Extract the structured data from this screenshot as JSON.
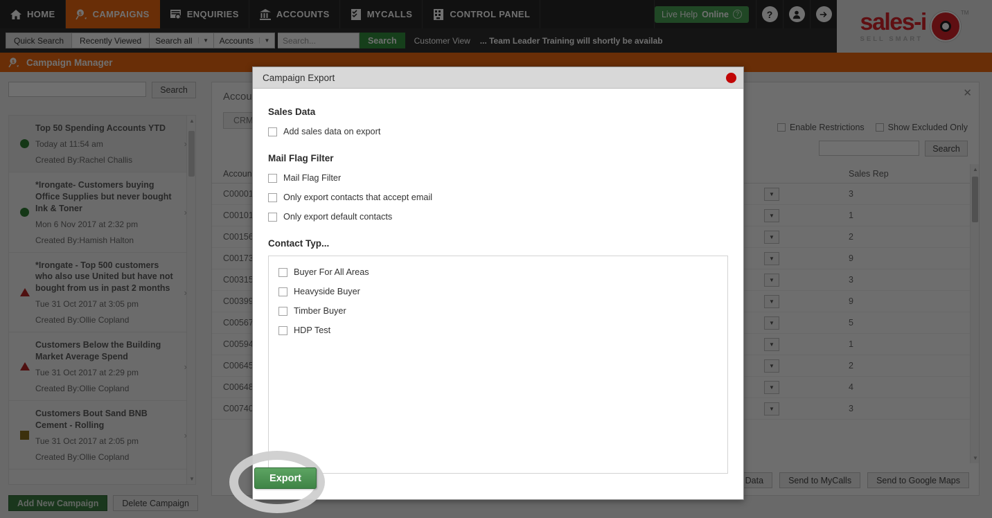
{
  "topnav": {
    "items": [
      {
        "label": "HOME",
        "icon": "home-icon",
        "active": false
      },
      {
        "label": "CAMPAIGNS",
        "icon": "campaigns-icon",
        "active": true
      },
      {
        "label": "ENQUIRIES",
        "icon": "enquiries-icon",
        "active": false
      },
      {
        "label": "ACCOUNTS",
        "icon": "accounts-icon",
        "active": false
      },
      {
        "label": "MYCALLS",
        "icon": "mycalls-icon",
        "active": false
      },
      {
        "label": "CONTROL PANEL",
        "icon": "control-panel-icon",
        "active": false
      }
    ],
    "live_help_prefix": "Live Help",
    "live_help_status": "Online",
    "help_icon": "question-mark-icon",
    "account_icon": "user-avatar-icon",
    "logout_icon": "arrow-right-icon",
    "accent_orange": "#ef6a12",
    "accent_green": "#4aa254"
  },
  "logo": {
    "name": "sales-i",
    "tagline": "SELL SMART",
    "tm": "TM",
    "brand_red": "#d9242a"
  },
  "searchbar": {
    "quick_search": "Quick Search",
    "recently_viewed": "Recently Viewed",
    "scope_select": "Search all",
    "type_select": "Accounts",
    "search_placeholder": "Search...",
    "search_button": "Search",
    "customer_view": "Customer View",
    "ticker": "... Team Leader Training will shortly be availab"
  },
  "page_header": {
    "title": "Campaign Manager",
    "icon": "campaign-manager-icon"
  },
  "sidebar": {
    "search_value": "",
    "search_button": "Search",
    "add_button": "Add New Campaign",
    "delete_button": "Delete Campaign",
    "items": [
      {
        "title": "Top 50 Spending Accounts YTD",
        "date": "Today at 11:54 am",
        "created_by": "Created By:Rachel Challis",
        "status": "green",
        "selected": true
      },
      {
        "title": "*Irongate- Customers buying Office Supplies but never bought Ink & Toner",
        "date": "Mon 6 Nov 2017 at 2:32 pm",
        "created_by": "Created By:Hamish Halton",
        "status": "green",
        "selected": false
      },
      {
        "title": "*Irongate - Top 500 customers who also use United but have not bought from us in past 2 months",
        "date": "Tue 31 Oct 2017 at 3:05 pm",
        "created_by": "Created By:Ollie Copland",
        "status": "red",
        "selected": false
      },
      {
        "title": "Customers Below the Building Market Average Spend",
        "date": "Tue 31 Oct 2017 at 2:29 pm",
        "created_by": "Created By:Ollie Copland",
        "status": "red",
        "selected": false
      },
      {
        "title": "Customers Bout Sand BNB Cement - Rolling",
        "date": "Tue 31 Oct 2017 at 2:05 pm",
        "created_by": "Created By:Ollie Copland",
        "status": "amber",
        "selected": false
      }
    ]
  },
  "main": {
    "title": "Account",
    "close_icon": "close-icon",
    "crm_button": "CRM",
    "enable_restrictions": "Enable Restrictions",
    "show_excluded_only": "Show Excluded Only",
    "search_value": "",
    "search_button": "Search",
    "columns": {
      "account": "Account",
      "sales_rep": "Sales Rep"
    },
    "rows": [
      {
        "account": "C00001",
        "sales_rep": "3"
      },
      {
        "account": "C00101",
        "sales_rep": "1"
      },
      {
        "account": "C00156",
        "sales_rep": "2"
      },
      {
        "account": "C00173",
        "sales_rep": "9"
      },
      {
        "account": "C00315",
        "sales_rep": "3"
      },
      {
        "account": "C00399",
        "sales_rep": "9"
      },
      {
        "account": "C00567",
        "sales_rep": "5"
      },
      {
        "account": "C00594",
        "sales_rep": "1"
      },
      {
        "account": "C00645",
        "sales_rep": "2"
      },
      {
        "account": "C00648",
        "sales_rep": "4"
      },
      {
        "account": "C00740",
        "sales_rep": "3"
      }
    ],
    "footer_buttons": [
      "Export Data",
      "Send to MyCalls",
      "Send to Google Maps"
    ]
  },
  "modal": {
    "title": "Campaign Export",
    "close_icon": "close-circle-icon",
    "close_color": "#c10606",
    "sections": {
      "sales_data": {
        "heading": "Sales Data",
        "options": [
          {
            "label": "Add sales data on export",
            "checked": false
          }
        ]
      },
      "mail_flag_filter": {
        "heading": "Mail Flag Filter",
        "options": [
          {
            "label": "Mail Flag Filter",
            "checked": false
          },
          {
            "label": "Only export contacts that accept email",
            "checked": false
          },
          {
            "label": "Only export default contacts",
            "checked": false
          }
        ]
      },
      "contact_types": {
        "heading": "Contact Typ...",
        "options": [
          {
            "label": "Buyer For All Areas",
            "checked": false
          },
          {
            "label": "Heavyside Buyer",
            "checked": false
          },
          {
            "label": "Timber Buyer",
            "checked": false
          },
          {
            "label": "HDP Test",
            "checked": false
          }
        ]
      }
    },
    "export_button": "Export",
    "export_button_color": "#3f8446",
    "highlight": "ring"
  }
}
